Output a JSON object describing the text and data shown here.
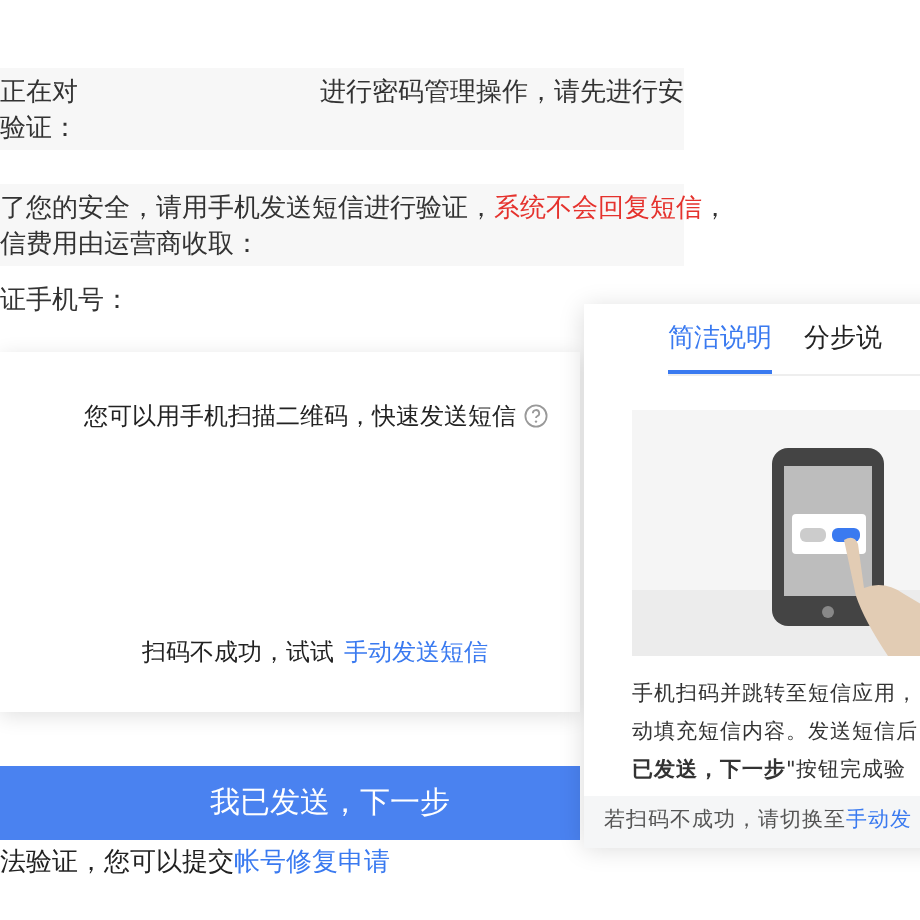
{
  "notice": {
    "lead": "正在对",
    "rest": "进行密码管理操作，请先进行安",
    "line2": "验证："
  },
  "sms_notice": {
    "text": "了您的安全，请用手机发送短信进行验证，",
    "warning": "系统不会回复短信",
    "tail": "，",
    "line2": "信费用由运营商收取："
  },
  "phone_label": "证手机号：",
  "qr_card": {
    "hint": "您可以用手机扫描二维码，快速发送短信",
    "fail_text": "扫码不成功，试试",
    "fail_link": "手动发送短信"
  },
  "next_button": "我已发送，下一步",
  "repair": {
    "text": "法验证，您可以提交",
    "link": "帐号修复申请"
  },
  "popover": {
    "tabs": [
      {
        "label": "简洁说明",
        "selected": true
      },
      {
        "label": "分步说",
        "selected": false
      }
    ],
    "lines": [
      "手机扫码并跳转至短信应用，",
      "动填充短信内容。发送短信后",
      "**已发送，下一步**\"按钮完成验"
    ],
    "footer_text": "若扫码不成功，请切换至",
    "footer_link": "手动发"
  }
}
